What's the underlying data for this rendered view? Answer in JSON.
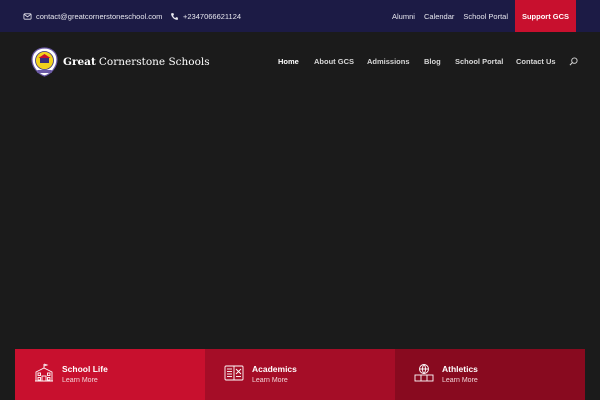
{
  "topbar": {
    "email": "contact@greatcornerstoneschool.com",
    "phone": "+2347066621124",
    "links": [
      "Alumni",
      "Calendar",
      "School Portal"
    ],
    "support_label": "Support GCS",
    "email_icon": "envelope-icon",
    "phone_icon": "phone-icon"
  },
  "brand": {
    "name_bold": "Great",
    "name_rest": "Cornerstone Schools",
    "logo_icon": "school-crest-logo"
  },
  "nav": {
    "items": [
      "Home",
      "About GCS",
      "Admissions",
      "Blog",
      "School Portal",
      "Contact Us"
    ],
    "active": "Home",
    "search_icon": "search-icon"
  },
  "cards": [
    {
      "title": "School Life",
      "link": "Learn More",
      "icon": "school-building-icon"
    },
    {
      "title": "Academics",
      "link": "Learn More",
      "icon": "open-book-icon"
    },
    {
      "title": "Athletics",
      "link": "Learn More",
      "icon": "sports-ball-icon"
    }
  ],
  "colors": {
    "topbar_bg": "#1c1b45",
    "accent": "#c8102e",
    "hero_bg": "#1b1b1b",
    "card1": "#c8102e",
    "card2": "#a50d27",
    "card3": "#880a1f"
  }
}
